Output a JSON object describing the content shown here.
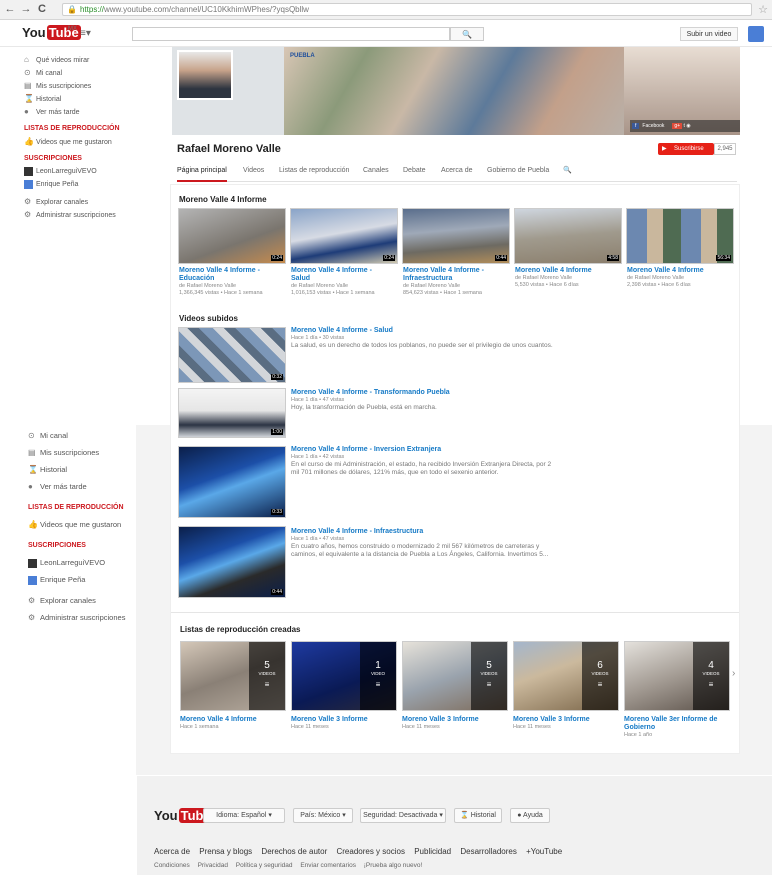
{
  "browser": {
    "url_prefix": "https://",
    "url_rest": "www.youtube.com/channel/UC10KkhimWPhes/?yqsQbllw",
    "back": "←",
    "forward": "→",
    "reload": "C",
    "star": "☆"
  },
  "header": {
    "logo_you": "You",
    "logo_tube": "Tube",
    "country": "MX",
    "search_icon": "🔍",
    "upload_label": "Subir un video"
  },
  "sidebar_top": {
    "items": [
      {
        "icon": "⌂",
        "label": "Qué videos mirar"
      },
      {
        "icon": "⊙",
        "label": "Mi canal"
      },
      {
        "icon": "▤",
        "label": "Mis suscripciones"
      },
      {
        "icon": "⌛",
        "label": "Historial"
      },
      {
        "icon": "●",
        "label": "Ver más tarde"
      }
    ],
    "playlists_head": "LISTAS DE REPRODUCCIÓN",
    "liked": "Videos que me gustaron",
    "subs_head": "SUSCRIPCIONES",
    "subs": [
      "LeonLarreguiVEVO",
      "Enrique Peña"
    ],
    "explore": "Explorar canales",
    "manage": "Administrar suscripciones"
  },
  "sidebar_bottom": {
    "items": [
      {
        "icon": "⊙",
        "label": "Mi canal"
      },
      {
        "icon": "▤",
        "label": "Mis suscripciones"
      },
      {
        "icon": "⌛",
        "label": "Historial"
      },
      {
        "icon": "●",
        "label": "Ver más tarde"
      }
    ],
    "playlists_head": "LISTAS DE REPRODUCCIÓN",
    "liked": "Videos que me gustaron",
    "subs_head": "SUSCRIPCIONES",
    "subs": [
      "LeonLarreguiVEVO",
      "Enrique Peña"
    ],
    "explore": "Explorar canales",
    "manage": "Administrar suscripciones"
  },
  "channel": {
    "name": "Rafael Moreno Valle",
    "banner_logo": "PUEBLA",
    "social_fb": "Facebook",
    "subscribe": "Suscribirse",
    "sub_count": "2,945",
    "tabs": [
      "Página principal",
      "Videos",
      "Listas de reproducción",
      "Canales",
      "Debate",
      "Acerca de",
      "Gobierno de Puebla",
      "🔍"
    ]
  },
  "featured": {
    "title": "Moreno Valle 4 Informe",
    "videos": [
      {
        "t1": "Moreno Valle 4 Informe -",
        "t2": "Educación",
        "by": "de Rafael Moreno Valle",
        "stats": "1,366,345 vistas • Hace 1 semana",
        "dur": "0:24"
      },
      {
        "t1": "Moreno Valle 4 Informe -",
        "t2": "Salud",
        "by": "de Rafael Moreno Valle",
        "stats": "1,016,153 vistas • Hace 1 semana",
        "dur": "0:24"
      },
      {
        "t1": "Moreno Valle 4 Informe -",
        "t2": "Infraestructura",
        "by": "de Rafael Moreno Valle",
        "stats": "854,623 vistas • Hace 1 semana",
        "dur": "0:44"
      },
      {
        "t1": "Moreno Valle 4 Informe",
        "t2": "",
        "by": "de Rafael Moreno Valle",
        "stats": "5,530 vistas • Hace 6 días",
        "dur": "4:58"
      },
      {
        "t1": "Moreno Valle 4 Informe",
        "t2": "",
        "by": "de Rafael Moreno Valle",
        "stats": "2,398 vistas • Hace 6 días",
        "dur": "56:34"
      }
    ]
  },
  "uploads": {
    "title": "Videos subidos",
    "videos": [
      {
        "title": "Moreno Valle 4 Informe - Salud",
        "meta": "Hace 1 día • 30 vistas",
        "desc": "La salud, es un derecho de todos los poblanos, no puede ser el privilegio de unos cuantos.",
        "dur": "0:32"
      },
      {
        "title": "Moreno Valle 4 Informe - Transformando Puebla",
        "meta": "Hace 1 día • 47 vistas",
        "desc": "Hoy, la transformación de Puebla, está en marcha.",
        "dur": "1:00"
      },
      {
        "title": "Moreno Valle 4 Informe - Inversion Extranjera",
        "meta": "Hace 1 día • 42 vistas",
        "desc": "En el curso de mi Administración, el estado, ha recibido Inversión Extranjera Directa, por 2 mil 701 millones de dólares, 121% más, que en todo el sexenio anterior.",
        "dur": "0:33"
      },
      {
        "title": "Moreno Valle 4 Informe - Infraestructura",
        "meta": "Hace 1 día • 47 vistas",
        "desc": "En cuatro años, hemos construido o modernizado 2 mil 567 kilómetros de carreteras y caminos, el equivalente a la distancia de Puebla a Los Ángeles, California. Invertimos 5...",
        "dur": "0:44"
      }
    ]
  },
  "playlists": {
    "title": "Listas de reproducción creadas",
    "items": [
      {
        "title": "Moreno Valle 4 Informe",
        "meta": "Hace 1 semana",
        "count": "5",
        "label": "VIDEOS"
      },
      {
        "title": "Moreno Valle 3 Informe",
        "meta": "Hace 11 meses",
        "count": "1",
        "label": "VIDEO"
      },
      {
        "title": "Moreno Valle 3 Informe",
        "meta": "Hace 11 meses",
        "count": "5",
        "label": "VIDEOS"
      },
      {
        "title": "Moreno Valle 3 Informe",
        "meta": "Hace 11 meses",
        "count": "6",
        "label": "VIDEOS"
      },
      {
        "title": "Moreno Valle 3er Informe de Gobierno",
        "meta": "Hace 1 año",
        "count": "4",
        "label": "VIDEOS"
      }
    ],
    "next": "›"
  },
  "footer": {
    "language": "Idioma: Español ▾",
    "country": "País: México ▾",
    "safety": "Seguridad: Desactivada ▾",
    "history": "Historial",
    "help": "Ayuda",
    "links": [
      "Acerca de",
      "Prensa y blogs",
      "Derechos de autor",
      "Creadores y socios",
      "Publicidad",
      "Desarrolladores",
      "+YouTube"
    ],
    "links2": [
      "Condiciones",
      "Privacidad",
      "Política y seguridad",
      "Enviar comentarios",
      "¡Prueba algo nuevo!"
    ]
  }
}
